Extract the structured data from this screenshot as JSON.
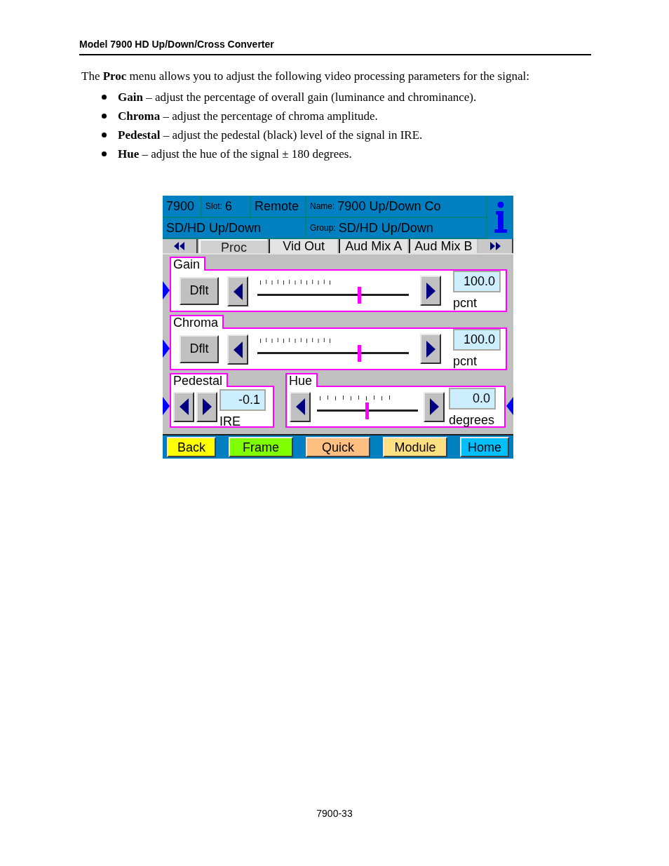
{
  "page_header": "Model 7900 HD Up/Down/Cross Converter",
  "intro": "The **Proc** menu allows you to adjust the following video processing parameters for the signal:",
  "bullets": [
    "**Gain** – adjust the percentage of overall gain (luminance and chrominance).",
    "**Chroma** – adjust the percentage of chroma amplitude.",
    "**Pedestal** – adjust the pedestal (black) level of the signal in IRE.",
    "**Hue** – adjust the hue of the signal ± 180 degrees."
  ],
  "screen": {
    "status_row1": [
      {
        "value": "7900"
      },
      {
        "label": "Slot:",
        "value": "6"
      },
      {
        "value": "Remote"
      },
      {
        "label": "Name:",
        "value": "7900 Up/Down Co"
      }
    ],
    "status_row2": [
      {
        "value": "SD/HD Up/Down"
      },
      {
        "label": "Group:",
        "value": "SD/HD Up/Down"
      }
    ],
    "tabs": [
      {
        "label": "Proc",
        "selected": true
      },
      {
        "label": "Vid Out",
        "selected": false
      },
      {
        "label": "Aud Mix A",
        "selected": false
      },
      {
        "label": "Aud Mix B",
        "selected": false
      }
    ],
    "controls": [
      {
        "kind": "slider",
        "title": "Gain",
        "default_button": "Dflt",
        "level": 0.67,
        "value": "100.0",
        "unit": "pcnt",
        "pointer_left": true,
        "pointer_right": false
      },
      {
        "kind": "slider",
        "title": "Chroma",
        "default_button": "Dflt",
        "level": 0.67,
        "value": "100.0",
        "unit": "pcnt",
        "pointer_left": true,
        "pointer_right": false
      }
    ],
    "bottom_controls": [
      {
        "kind": "stepper",
        "title": "Pedestal",
        "value": "-0.1",
        "unit": "IRE",
        "pointer_left": true,
        "pointer_right": false
      },
      {
        "kind": "compact_slider",
        "title": "Hue",
        "level": 0.49,
        "value": "0.0",
        "unit": "degrees",
        "pointer_left": false,
        "pointer_right": true
      }
    ],
    "buttons": [
      {
        "label": "Back",
        "color": "#ffff00"
      },
      {
        "label": "Frame",
        "color": "#80ff00"
      },
      {
        "label": "Quick",
        "color": "#ffbf80"
      },
      {
        "label": "Module",
        "color": "#ffdf80"
      },
      {
        "label": "Home",
        "color": "#00bfff"
      }
    ]
  },
  "page_number": "7900-33"
}
